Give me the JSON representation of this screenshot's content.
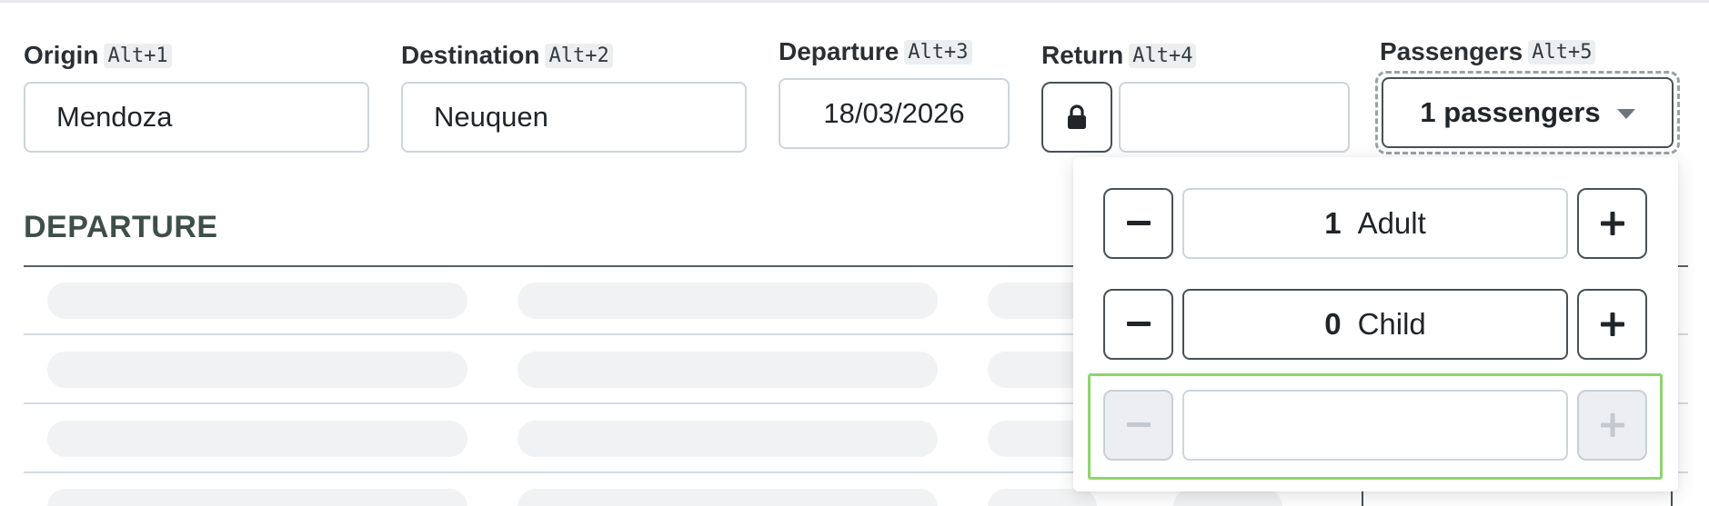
{
  "search": {
    "origin": {
      "label": "Origin",
      "shortcut": "Alt+1",
      "value": "Mendoza"
    },
    "destination": {
      "label": "Destination",
      "shortcut": "Alt+2",
      "value": "Neuquen"
    },
    "departure": {
      "label": "Departure",
      "shortcut": "Alt+3",
      "value": "18/03/2026"
    },
    "return": {
      "label": "Return",
      "shortcut": "Alt+4",
      "value": ""
    },
    "passengers": {
      "label": "Passengers",
      "shortcut": "Alt+5",
      "button_label": "1 passengers"
    }
  },
  "results": {
    "section_title": "DEPARTURE"
  },
  "passenger_dropdown": {
    "rows": [
      {
        "count": "1",
        "type": "Adult"
      },
      {
        "count": "0",
        "type": "Child"
      },
      {
        "count": "",
        "type": ""
      }
    ]
  },
  "icons": {
    "lock": "lock-icon",
    "caret": "caret-down-icon",
    "minus": "minus-icon",
    "plus": "plus-icon"
  },
  "colors": {
    "highlight": "#8fd46c",
    "section_title": "#3e4f49",
    "border": "#ced4da",
    "dark_border": "#495057"
  }
}
